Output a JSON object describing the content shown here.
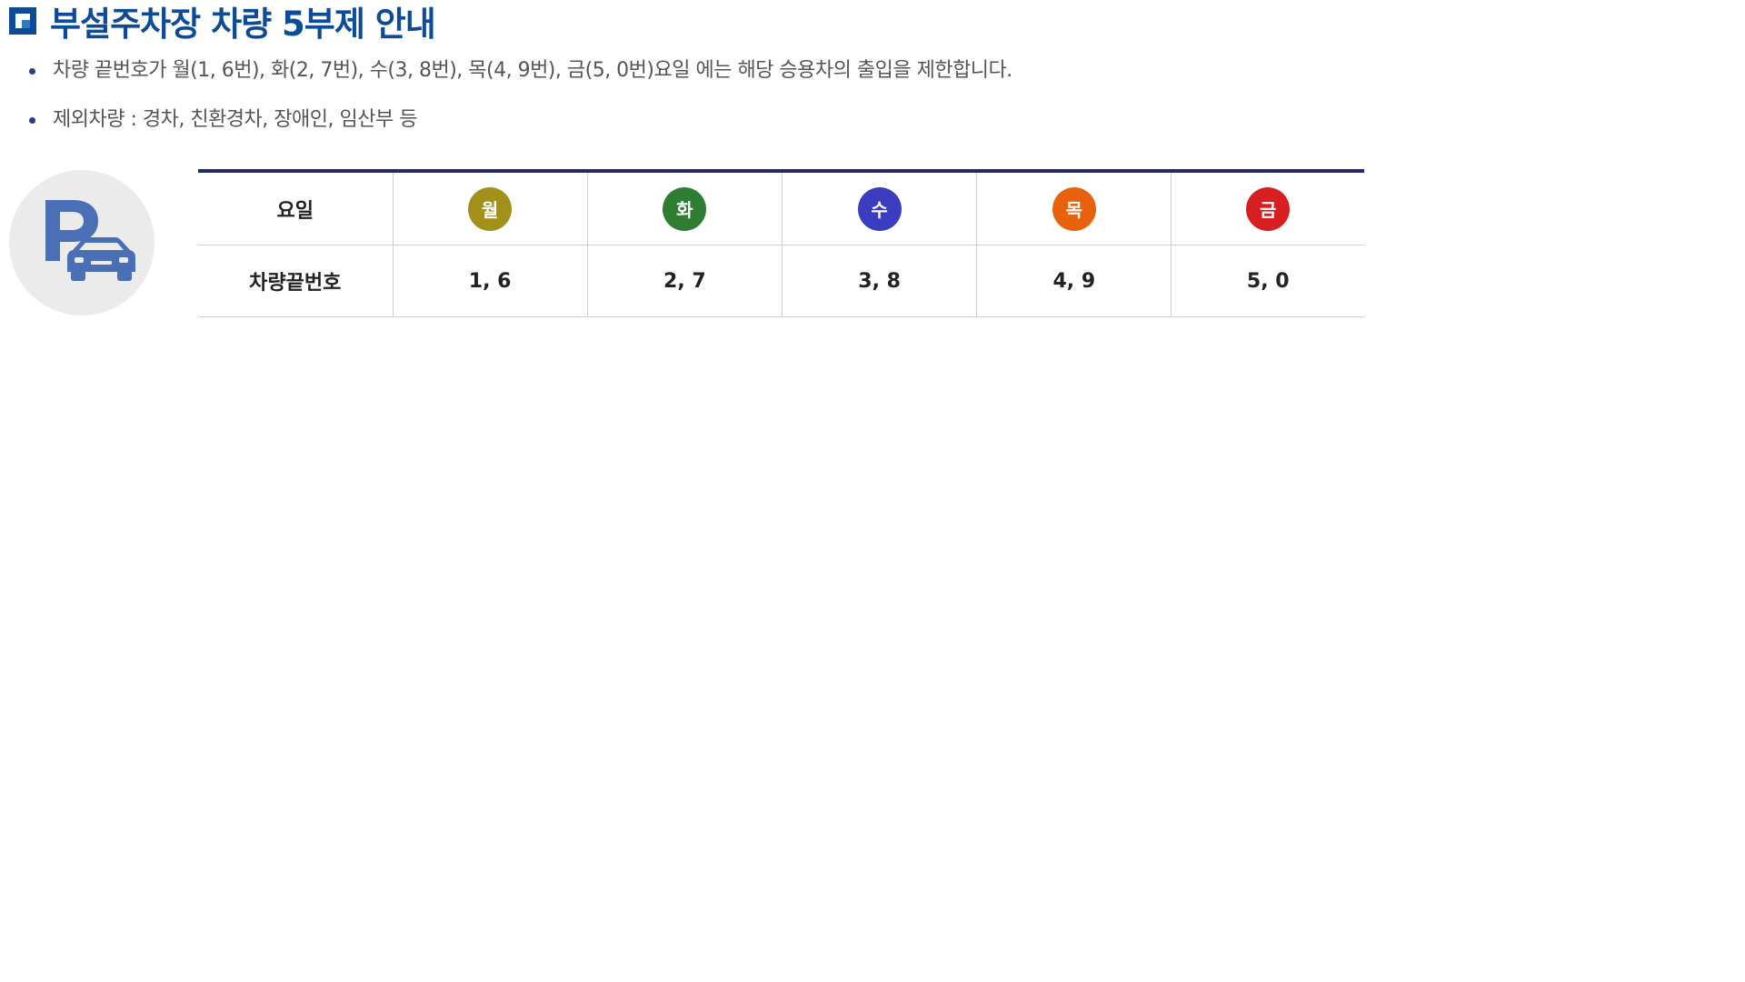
{
  "header": {
    "title": "부설주차장 차량 5부제 안내",
    "icon": "square-bullet-icon"
  },
  "bullets": [
    "차량 끝번호가 월(1, 6번), 화(2, 7번), 수(3, 8번), 목(4, 9번), 금(5, 0번)요일 에는 해당 승용차의 출입을 제한합니다.",
    "제외차량 : 경차, 친환경차, 장애인, 임산부 등"
  ],
  "parking_icon": "parking-car-icon",
  "table": {
    "row_headers": {
      "day": "요일",
      "plate": "차량끝번호"
    },
    "days": [
      {
        "label": "월",
        "numbers": "1, 6",
        "color": "#a3901a"
      },
      {
        "label": "화",
        "numbers": "2, 7",
        "color": "#2e7d32"
      },
      {
        "label": "수",
        "numbers": "3, 8",
        "color": "#3b3dc0"
      },
      {
        "label": "목",
        "numbers": "4, 9",
        "color": "#e8620e"
      },
      {
        "label": "금",
        "numbers": "5, 0",
        "color": "#d71f22"
      }
    ]
  }
}
